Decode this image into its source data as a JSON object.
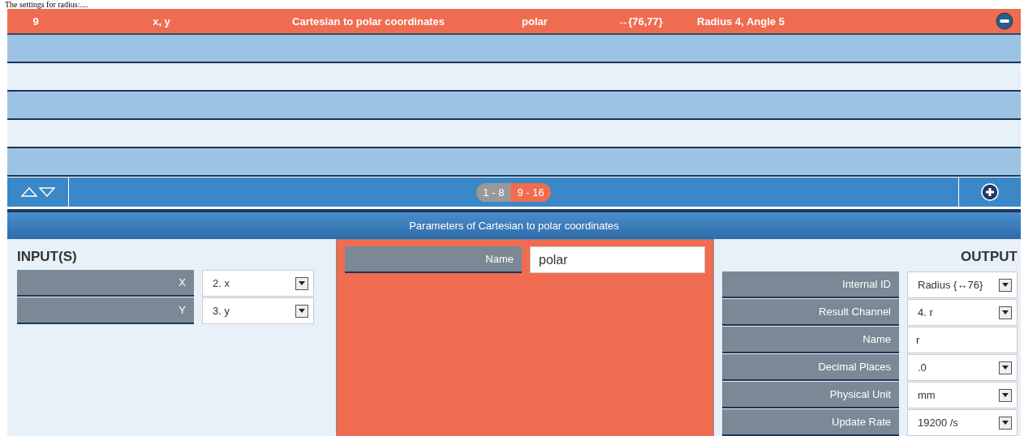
{
  "caption": "The settings for radius:....",
  "table": {
    "rows": [
      {
        "cells": [
          "9",
          "x, y",
          "Cartesian to polar coordinates",
          "polar",
          "↔{76,77}",
          "Radius 4, Angle 5"
        ],
        "selected": true
      }
    ]
  },
  "pagination": [
    {
      "label": "1 - 8",
      "selected": false
    },
    {
      "label": "9 - 16",
      "selected": true
    }
  ],
  "panel_title": "Parameters of Cartesian to polar coordinates",
  "inputs": {
    "title": "INPUT(S)",
    "fields": [
      {
        "label": "X",
        "value": "2. x",
        "kind": "dropdown"
      },
      {
        "label": "Y",
        "value": "3. y",
        "kind": "dropdown"
      }
    ]
  },
  "middle": {
    "fields": [
      {
        "label": "Name",
        "value": "polar",
        "kind": "text"
      }
    ]
  },
  "output": {
    "title": "OUTPUT",
    "fields": [
      {
        "label": "Internal ID",
        "value": "Radius {↔76}",
        "kind": "dropdown"
      },
      {
        "label": "Result Channel",
        "value": "4. r",
        "kind": "dropdown"
      },
      {
        "label": "Name",
        "value": "r",
        "kind": "text"
      },
      {
        "label": "Decimal Places",
        "value": ".0",
        "kind": "dropdown"
      },
      {
        "label": "Physical Unit",
        "value": "mm",
        "kind": "dropdown"
      },
      {
        "label": "Update Rate",
        "value": "19200 /s",
        "kind": "dropdown"
      }
    ]
  }
}
